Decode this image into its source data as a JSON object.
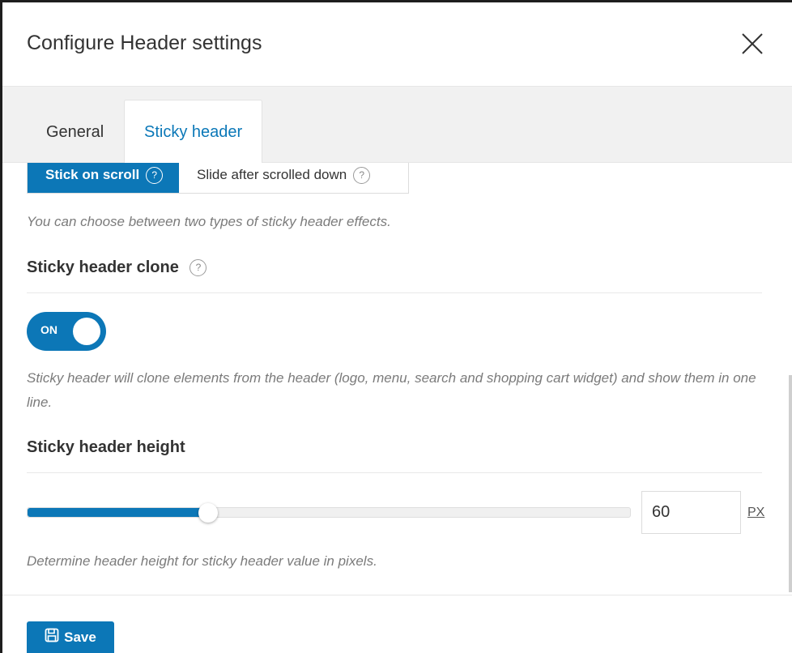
{
  "modal": {
    "title": "Configure Header settings",
    "close_icon": "close-icon"
  },
  "tabs": [
    {
      "label": "General",
      "active": false
    },
    {
      "label": "Sticky header",
      "active": true
    }
  ],
  "sticky_effect": {
    "options": [
      {
        "label": "Stick on scroll",
        "selected": true
      },
      {
        "label": "Slide after scrolled down",
        "selected": false
      }
    ],
    "help_icon": "?",
    "description": "You can choose between two types of sticky header effects."
  },
  "sticky_clone": {
    "label": "Sticky header clone",
    "toggle_text": "ON",
    "enabled": true,
    "description": "Sticky header will clone elements from the header (logo, menu, search and shopping cart widget) and show them in one line."
  },
  "sticky_height": {
    "label": "Sticky header height",
    "value": "60",
    "slider_fraction": 0.3,
    "unit": "PX",
    "description": "Determine header height for sticky header value in pixels."
  },
  "footer": {
    "save_label": "Save",
    "save_icon": "save-icon"
  },
  "colors": {
    "accent": "#0c77b7"
  }
}
